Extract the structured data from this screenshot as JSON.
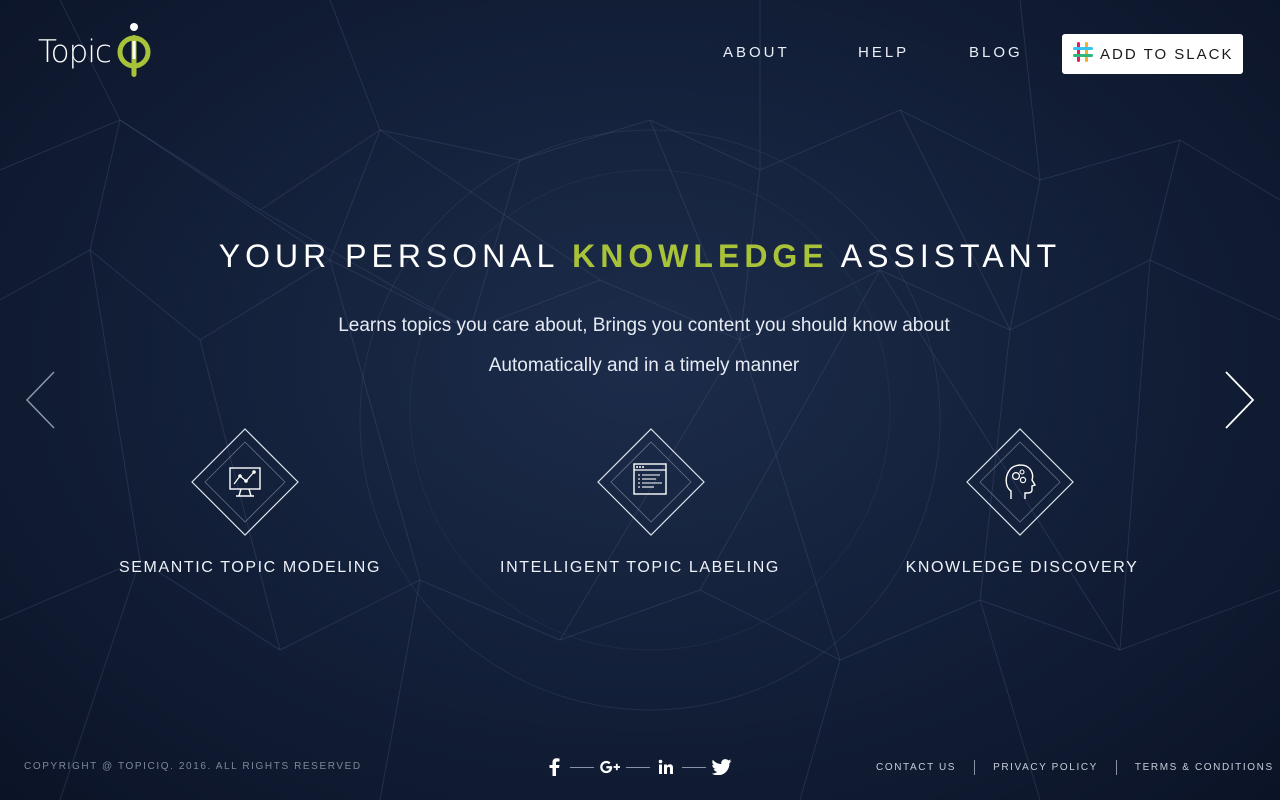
{
  "brand": {
    "logo_text": "Topic",
    "logo_mark": "iq-mark-icon",
    "accent_color": "#a8c23a"
  },
  "nav": {
    "items": [
      {
        "label": "ABOUT"
      },
      {
        "label": "HELP"
      },
      {
        "label": "BLOG"
      }
    ],
    "cta_label": "ADD TO SLACK",
    "cta_icon": "slack-icon"
  },
  "hero": {
    "title_before": "YOUR PERSONAL ",
    "title_accent": "KNOWLEDGE",
    "title_after": " ASSISTANT",
    "subtitle_line1": "Learns topics you care about, Brings you content you should know about",
    "subtitle_line2": "Automatically and in a timely manner"
  },
  "carousel": {
    "prev_icon": "chevron-left-icon",
    "next_icon": "chevron-right-icon"
  },
  "features": [
    {
      "label": "SEMANTIC TOPIC MODELING",
      "icon": "monitor-chart-icon"
    },
    {
      "label": "INTELLIGENT TOPIC LABELING",
      "icon": "document-list-icon"
    },
    {
      "label": "KNOWLEDGE DISCOVERY",
      "icon": "head-gears-icon"
    }
  ],
  "footer": {
    "copyright": "COPYRIGHT @ TOPICIQ. 2016. ALL RIGHTS RESERVED",
    "social": [
      "facebook-icon",
      "google-plus-icon",
      "linkedin-icon",
      "twitter-icon"
    ],
    "links": [
      {
        "label": "CONTACT US"
      },
      {
        "label": "PRIVACY POLICY"
      },
      {
        "label": "TERMS & CONDITIONS"
      }
    ]
  }
}
